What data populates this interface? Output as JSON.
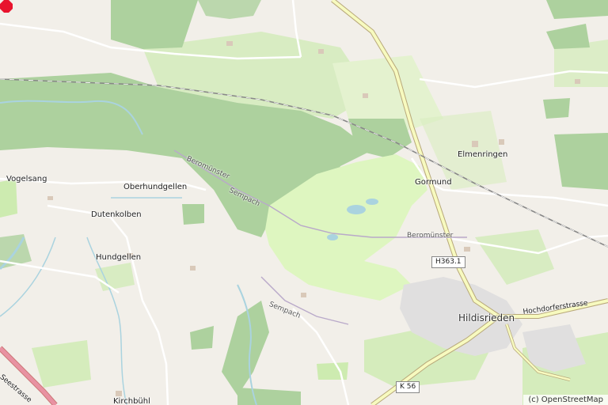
{
  "map": {
    "places": {
      "vogelsang": "Vogelsang",
      "oberhundgellen": "Oberhundgellen",
      "dutenkolben": "Dutenkolben",
      "hundgellen": "Hundgellen",
      "kirchbuehl": "Kirchbühl",
      "gormund": "Gormund",
      "elmenringen": "Elmenringen",
      "hildisrieden": "Hildisrieden"
    },
    "railway_labels": {
      "beromuenster_1": "Beromünster",
      "sempach_1": "Sempach",
      "beromuenster_2": "Beromünster",
      "sempach_2": "Sempach"
    },
    "streets": {
      "hochdorferstrasse": "Hochdorferstrasse",
      "seestrasse": "Seestrasse"
    },
    "road_shields": {
      "h363_1": "H363.1",
      "k56": "K 56"
    },
    "marker": {
      "icon": "location-marker-icon",
      "color": "#e8132d"
    },
    "colors": {
      "background": "#f2efe9",
      "forest": "#add19e",
      "meadow": "#cdebb0",
      "golf": "#def6c0",
      "residential": "#e0dfdf",
      "main_road": "#f7fabf",
      "water": "#aad3df"
    }
  },
  "attribution": "(c) OpenStreetMap"
}
